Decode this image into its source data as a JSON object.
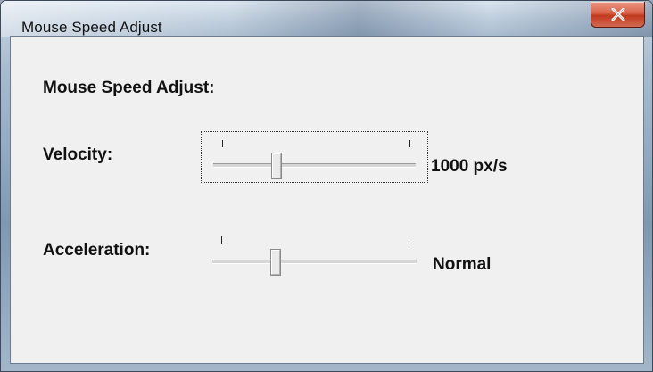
{
  "window": {
    "title": "Mouse Speed Adjust"
  },
  "dialog": {
    "heading": "Mouse Speed Adjust:",
    "velocity": {
      "label": "Velocity:",
      "value_text": "1000 px/s",
      "level": 0.3
    },
    "acceleration": {
      "label": "Acceleration:",
      "value_text": "Normal",
      "level": 0.3
    }
  },
  "icons": {
    "close": "close-icon"
  },
  "colors": {
    "close_button": "#d9634a",
    "client_bg": "#f0f0f0"
  }
}
